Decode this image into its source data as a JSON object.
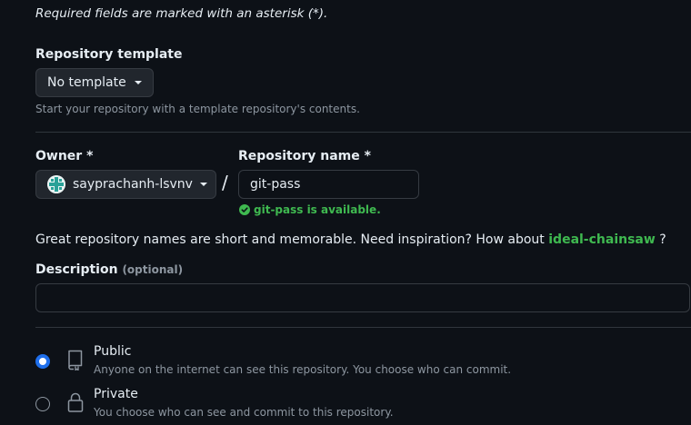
{
  "form": {
    "required_note": "Required fields are marked with an asterisk (*)."
  },
  "template": {
    "label": "Repository template",
    "selected": "No template",
    "helper": "Start your repository with a template repository's contents."
  },
  "owner": {
    "label": "Owner *",
    "selected": "sayprachanh-lsvnv"
  },
  "separator": "/",
  "repo_name": {
    "label": "Repository name *",
    "value": "git-pass",
    "availability": "git-pass is available."
  },
  "inspiration": {
    "text": "Great repository names are short and memorable. Need inspiration? How about",
    "suggestion": "ideal-chainsaw",
    "tail": "?"
  },
  "description": {
    "label": "Description",
    "optional": "(optional)",
    "value": ""
  },
  "visibility": {
    "public": {
      "title": "Public",
      "desc": "Anyone on the internet can see this repository. You choose who can commit.",
      "selected": true
    },
    "private": {
      "title": "Private",
      "desc": "You choose who can see and commit to this repository.",
      "selected": false
    }
  },
  "colors": {
    "background": "#0d1117",
    "success": "#3fb950",
    "accent": "#1f6feb"
  }
}
